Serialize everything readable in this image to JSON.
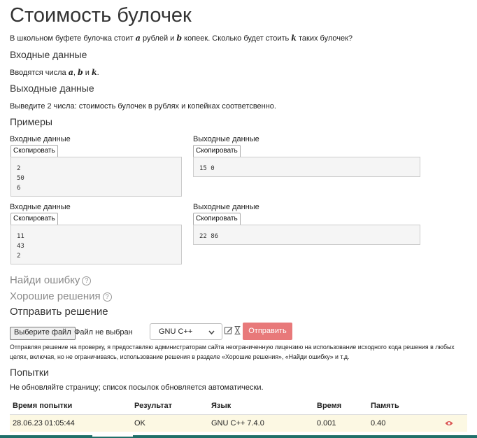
{
  "problem": {
    "title": "Стоимость булочек",
    "statement_pre": "В школьном буфете булочка стоит",
    "var_a": "a",
    "statement_mid1": "рублей и",
    "var_b": "b",
    "statement_mid2": "копеек. Сколько будет стоить",
    "var_k": "k",
    "statement_post": "таких булочек?",
    "input_heading": "Входные данные",
    "input_text_pre": "Вводятся числа",
    "input_sep1": ",",
    "input_sep2": "и",
    "input_end": ".",
    "output_heading": "Выходные данные",
    "output_text": "Выведите 2 числа: стоимость булочек в рублях и копейках соответсвенно.",
    "examples_heading": "Примеры"
  },
  "examples": [
    {
      "input_label": "Входные данные",
      "output_label": "Выходные данные",
      "copy_label": "Скопировать",
      "input": "2\n50\n6",
      "output": "15 0"
    },
    {
      "input_label": "Входные данные",
      "output_label": "Выходные данные",
      "copy_label": "Скопировать",
      "input": "11\n43\n2",
      "output": "22 86"
    }
  ],
  "sections": {
    "find_error": "Найди ошибку",
    "good_solutions": "Хорошие решения",
    "help_glyph": "?",
    "submit_heading": "Отправить решение"
  },
  "submit_form": {
    "file_button": "Выберите файл",
    "file_status": "Файл не выбран",
    "language": "GNU C++",
    "submit_label": "Отправить",
    "legal_text": "Отправляя решение на проверку, я предоставляю администраторам сайта неограниченную лицензию на использование исходного кода решения в любых целях, включая, но не ограничиваясь, использование решения в разделе «Хорошие решения», «Найди ошибку» и т.д."
  },
  "attempts": {
    "heading": "Попытки",
    "note": "Не обновляйте страницу; список посылок обновляется автоматически.",
    "columns": [
      "Время попытки",
      "Результат",
      "Язык",
      "Время",
      "Память"
    ],
    "rows": [
      {
        "time": "28.06.23 01:05:44",
        "result": "OK",
        "language": "GNU C++ 7.4.0",
        "run_time": "0.001",
        "memory": "0.40"
      }
    ]
  },
  "icons": {
    "edit": "edit-icon",
    "hourglass": "hourglass-icon",
    "eye": "eye-icon"
  },
  "colors": {
    "submit_bg": "#e8797a",
    "row_highlight": "#fcf8e3",
    "eye": "#d9534f",
    "bottom_bar": "#1f6f6a"
  }
}
